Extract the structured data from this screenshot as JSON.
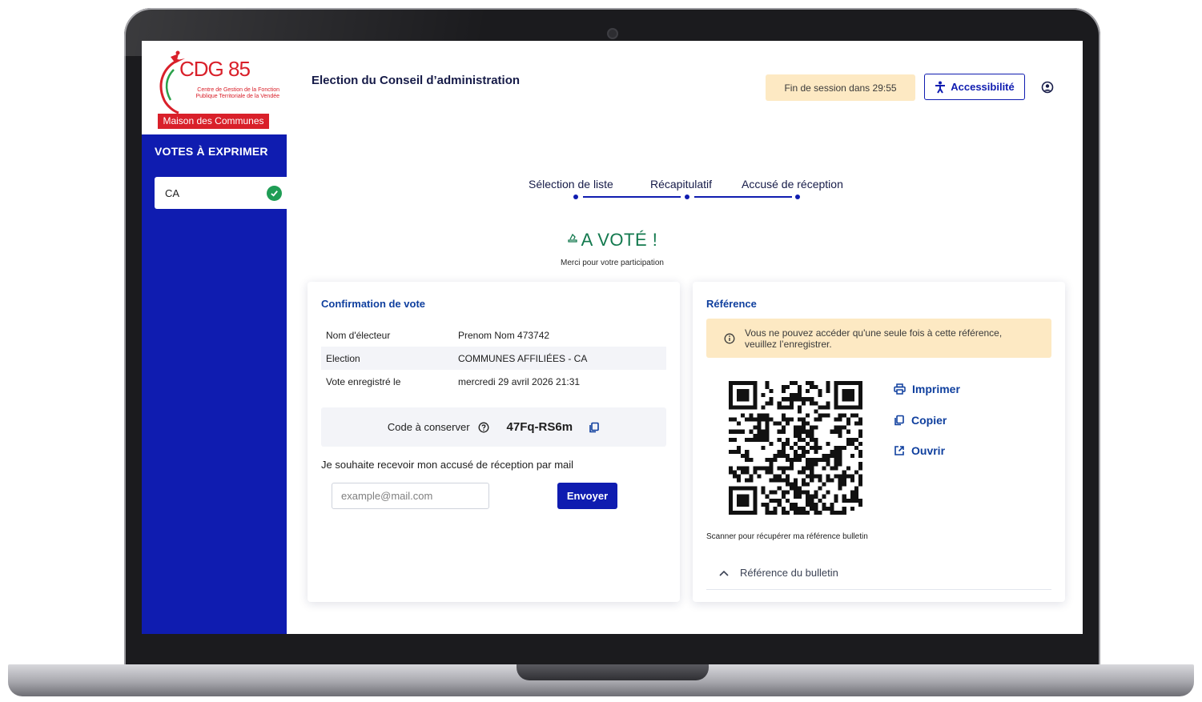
{
  "brand": {
    "logo_title": "CDG 85",
    "logo_subtitle": "Centre de Gestion de la Fonction Publique Territoriale de la Vendée",
    "logo_band": "Maison des Communes",
    "red": "#d9202a"
  },
  "sidebar": {
    "heading": "VOTES À EXPRIMER",
    "items": [
      {
        "label": "CA",
        "status": "done",
        "icon": "check-circle-icon"
      }
    ]
  },
  "header": {
    "title": "Election du Conseil d’administration",
    "session": "Fin de session dans 29:55",
    "accessibility": "Accessibilité"
  },
  "stepper": {
    "steps": [
      "Sélection de liste",
      "Récapitulatif",
      "Accusé de réception"
    ]
  },
  "result": {
    "title": "A VOTÉ !",
    "subtitle": "Merci pour votre participation",
    "color": "#13794e"
  },
  "confirmation": {
    "title": "Confirmation de vote",
    "rows": [
      {
        "label": "Nom d'électeur",
        "value": "Prenom Nom 473742"
      },
      {
        "label": "Election",
        "value": "COMMUNES AFFILIÉES - CA"
      },
      {
        "label": "Vote enregistré le",
        "value": "mercredi 29 avril 2026 21:31"
      }
    ],
    "code_label": "Code à conserver",
    "code_value": "47Fq-RS6m",
    "mail_label": "Je souhaite recevoir mon accusé de réception par mail",
    "mail_placeholder": "example@mail.com",
    "send": "Envoyer"
  },
  "reference": {
    "title": "Référence",
    "warning": "Vous ne pouvez accéder qu'une seule fois à cette référence, veuillez l’enregistrer.",
    "actions": {
      "print": "Imprimer",
      "copy": "Copier",
      "open": "Ouvrir"
    },
    "scan_text": "Scanner pour récupérer ma référence bulletin",
    "accordion": "Référence du bulletin"
  },
  "colors": {
    "primary": "#0f1cb0",
    "title_blue": "#0f3f9e",
    "warning_bg": "#fde9c3"
  }
}
